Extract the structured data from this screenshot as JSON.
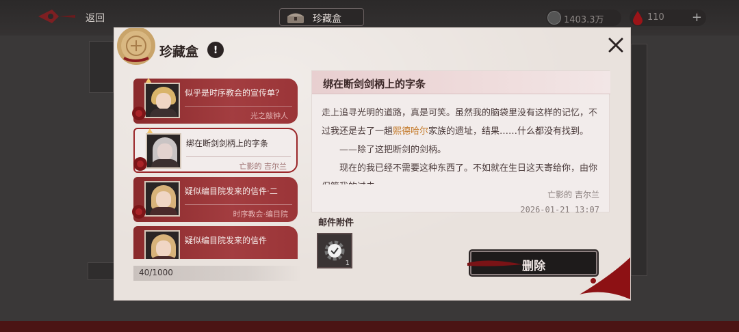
{
  "topbar": {
    "back_label": "返回",
    "title": "珍藏盒",
    "currency1": "1403.3万",
    "currency2": "110",
    "plus": "+"
  },
  "dialog": {
    "title": "珍藏盒",
    "info_badge": "!",
    "close_icon": "close-icon"
  },
  "mail_list": {
    "items": [
      {
        "subject": "似乎是时序教会的宣传单?",
        "sender": "光之敲钟人",
        "has_bell": true,
        "hair": "#d9b46a",
        "selected": false
      },
      {
        "subject": "绑在断剑剑柄上的字条",
        "sender": "亡影的 吉尔兰",
        "has_bell": true,
        "hair": "#c9c4c4",
        "selected": true
      },
      {
        "subject": "疑似编目院发来的信件·二",
        "sender": "时序教会·编目院",
        "has_bell": false,
        "hair": "#d8b37a",
        "selected": false
      },
      {
        "subject": "疑似编目院发来的信件",
        "sender": "",
        "has_bell": false,
        "hair": "#d8b37a",
        "selected": false
      }
    ],
    "count": "40/1000"
  },
  "detail": {
    "title": "绑在断剑剑柄上的字条",
    "line1_a": "走上追寻光明的道路，真是可笑。虽然我的脑袋里没有这样的记忆，不过我还是去了一趟",
    "line1_highlight": "熙德哈尔",
    "line1_b": "家族的遗址，结果……什么都没有找到。",
    "line2": "——除了这把断剑的剑柄。",
    "line3": "现在的我已经不需要这种东西了。不如就在生日这天寄给你，由你保管我的过去。",
    "signature": "亡影的 吉尔兰",
    "date": "2026-01-21  13:07",
    "highlight_color": "#c47a2a"
  },
  "attachments": {
    "label": "邮件附件",
    "items": [
      {
        "icon": "gear-icon",
        "qty": "1",
        "claimed": true
      }
    ]
  },
  "actions": {
    "delete_label": "删除"
  },
  "colors": {
    "accent_red": "#9a2528",
    "panel_bg": "#e9e2dd"
  }
}
